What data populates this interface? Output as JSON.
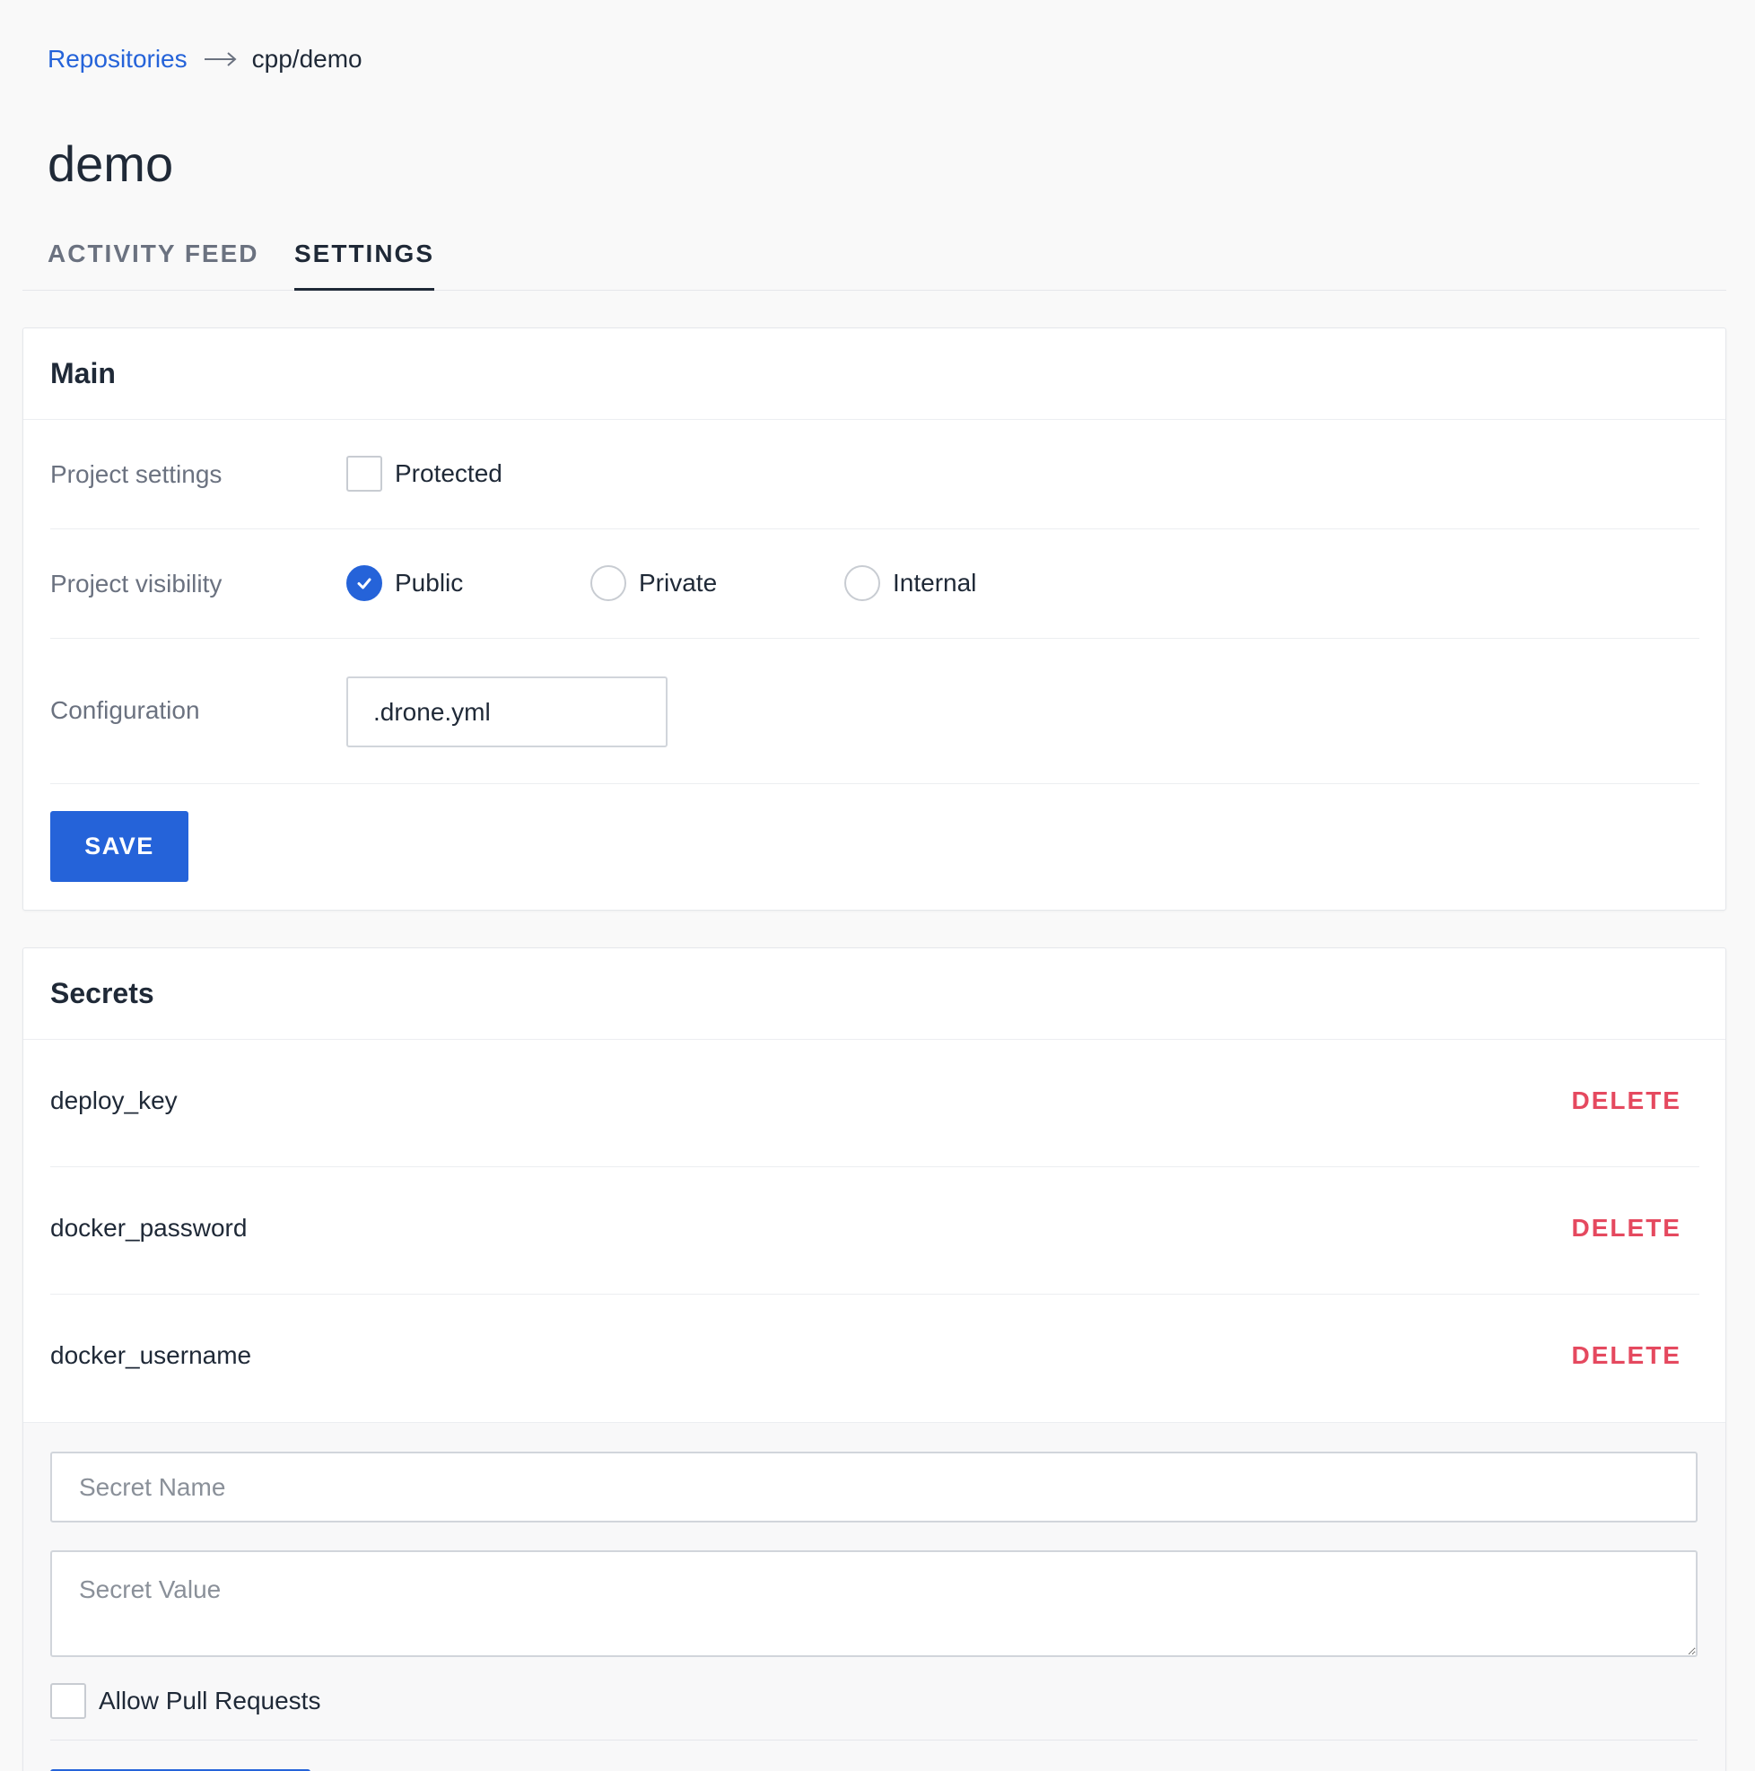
{
  "breadcrumb": {
    "parent": "Repositories",
    "current": "cpp/demo"
  },
  "page": {
    "title": "demo"
  },
  "tabs": [
    {
      "label": "ACTIVITY FEED",
      "active": false
    },
    {
      "label": "SETTINGS",
      "active": true
    }
  ],
  "main": {
    "heading": "Main",
    "project_settings": {
      "label": "Project settings",
      "protected_label": "Protected",
      "protected_checked": false
    },
    "project_visibility": {
      "label": "Project visibility",
      "options": [
        "Public",
        "Private",
        "Internal"
      ],
      "selected": "Public"
    },
    "configuration": {
      "label": "Configuration",
      "value": ".drone.yml"
    },
    "save_label": "SAVE"
  },
  "secrets": {
    "heading": "Secrets",
    "items": [
      {
        "name": "deploy_key",
        "action": "DELETE"
      },
      {
        "name": "docker_password",
        "action": "DELETE"
      },
      {
        "name": "docker_username",
        "action": "DELETE"
      }
    ],
    "form": {
      "name_placeholder": "Secret Name",
      "value_placeholder": "Secret Value",
      "allow_pr_label": "Allow Pull Requests",
      "allow_pr_checked": false
    }
  },
  "colors": {
    "accent": "#2563d9",
    "danger": "#e5495f",
    "background": "#f9f9f9"
  },
  "icons": {
    "breadcrumb_separator": "arrow-right-icon",
    "radio_selected": "check-icon"
  }
}
